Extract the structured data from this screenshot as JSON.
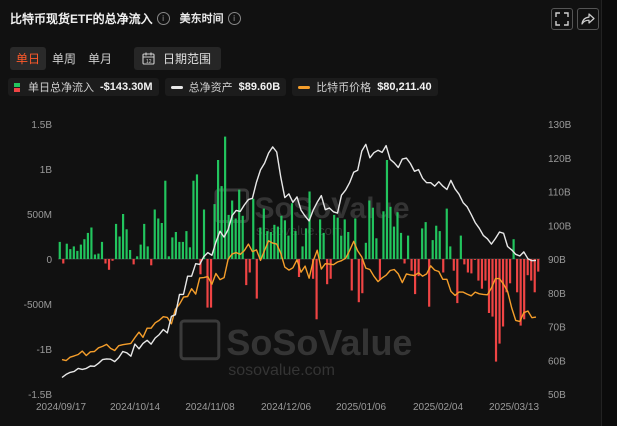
{
  "header": {
    "title": "比特币现货ETF的总净流入",
    "timezone_label": "美东时间",
    "fullscreen_icon": "fullscreen-icon",
    "share_icon": "share-icon"
  },
  "tabs": {
    "items": [
      "单日",
      "单周",
      "单月"
    ],
    "active": "单日",
    "date_range_label": "日期范围"
  },
  "legend": {
    "flow_label": "单日总净流入",
    "flow_value": "-$143.30M",
    "assets_label": "总净资产",
    "assets_value": "$89.60B",
    "price_label": "比特币价格",
    "price_value": "$80,211.40"
  },
  "watermark": {
    "brand": "SoSoValue",
    "url": "sosovalue.com"
  },
  "colors": {
    "positive": "#22c55e",
    "negative": "#ef4444",
    "assets_line": "#e8e8e8",
    "price_line": "#f59e2b",
    "background": "#111111",
    "active_tab": "#ff5a2a"
  },
  "chart_data": {
    "type": "bar",
    "left_axis": {
      "ticks": [
        "1.5B",
        "1B",
        "500M",
        "0",
        "-500M",
        "-1B",
        "-1.5B"
      ],
      "ylim": [
        -1.5,
        1.5
      ],
      "unit": "B"
    },
    "right_axis": {
      "ticks": [
        "130B",
        "120B",
        "110B",
        "100B",
        "90B",
        "80B",
        "70B",
        "60B",
        "50B"
      ],
      "ylim": [
        50,
        130
      ],
      "unit": "B"
    },
    "x_ticks": [
      "2024/09/17",
      "2024/10/14",
      "2024/11/08",
      "2024/12/06",
      "2025/01/06",
      "2025/02/04",
      "2025/03/13"
    ],
    "series": [
      {
        "name": "单日总净流入",
        "type": "bar",
        "values": [
          0.19,
          -0.05,
          0.17,
          0.11,
          0.14,
          0.09,
          0.16,
          0.22,
          0.29,
          0.35,
          0.05,
          0.06,
          0.19,
          -0.05,
          -0.12,
          -0.02,
          0.39,
          0.25,
          0.5,
          0.33,
          0.1,
          -0.06,
          0.03,
          0.16,
          0.39,
          0.14,
          -0.07,
          0.55,
          0.45,
          0.4,
          0.87,
          0.03,
          0.24,
          0.3,
          0.19,
          0.19,
          0.31,
          0.13,
          0.87,
          0.94,
          -0.17,
          0.55,
          -0.54,
          -0.54,
          0.61,
          1.1,
          0.81,
          1.36,
          0.49,
          0.65,
          0.45,
          0.77,
          0.48,
          -0.29,
          -0.15,
          0.67,
          -0.44,
          0.35,
          0.56,
          0.31,
          0.3,
          0.38,
          0.36,
          0.48,
          0.43,
          0.26,
          0.62,
          0.31,
          -0.2,
          0.14,
          0.34,
          0.75,
          -0.22,
          -0.67,
          0.44,
          0.29,
          -0.28,
          -0.22,
          0.49,
          0.46,
          0.26,
          0.44,
          0.3,
          -0.35,
          0.45,
          -0.48,
          -0.38,
          0.18,
          0.65,
          0.57,
          0.23,
          -0.23,
          0.53,
          1.1,
          0.58,
          0.36,
          0.52,
          0.29,
          -0.05,
          0.26,
          -0.13,
          -0.39,
          -0.19,
          0.34,
          0.41,
          -0.53,
          0.21,
          0.37,
          0.31,
          -0.15,
          0.56,
          0.14,
          -0.13,
          -0.49,
          0.26,
          -0.06,
          -0.15,
          -0.16,
          -0.01,
          -0.24,
          -0.33,
          -0.24,
          -0.6,
          -0.64,
          -1.14,
          -0.94,
          -0.75,
          -0.37,
          -0.27,
          0.22,
          -0.37,
          -0.74,
          -0.67,
          -0.18,
          -0.24,
          -0.37,
          -0.14
        ]
      },
      {
        "name": "总净资产",
        "type": "line",
        "values": [
          54.9,
          55.8,
          56.4,
          56.7,
          57.6,
          57.3,
          57.6,
          58.3,
          58.2,
          59.1,
          60.2,
          60.4,
          60.3,
          59.6,
          60.8,
          62.6,
          62.2,
          61.2,
          64.8,
          63.4,
          65.0,
          65.9,
          64.8,
          66.6,
          67.6,
          69.1,
          68.1,
          73.0,
          73.5,
          79.5,
          79.5,
          84.9,
          84.9,
          88.6,
          88.4,
          90.7,
          91.9,
          91.1,
          95.0,
          98.2,
          96.5,
          98.7,
          102.9,
          104.4,
          104.1,
          106.0,
          107.6,
          108.0,
          112.8,
          116.4,
          118.4,
          121.4,
          123.2,
          121.7,
          114.2,
          108.2,
          109.3,
          106.8,
          108.4,
          104.5,
          102.7,
          101.3,
          104.5,
          106.8,
          108.8,
          104.6,
          105.1,
          104.0,
          103.6,
          108.9,
          110.4,
          112.6,
          115.7,
          116.3,
          122.0,
          124.0,
          120.0,
          121.5,
          122.2,
          121.6,
          123.6,
          119.5,
          118.5,
          117.1,
          119.6,
          119.9,
          118.3,
          116.0,
          116.5,
          113.9,
          112.6,
          112.6,
          111.6,
          112.9,
          111.6,
          110.6,
          113.3,
          110.8,
          109.2,
          106.7,
          105.5,
          103.2,
          100.8,
          99.1,
          97.0,
          96.0,
          94.4,
          96.1,
          98.0,
          97.6,
          93.7,
          92.7,
          91.4,
          90.9,
          92.1,
          90.1,
          89.5,
          89.6
        ]
      },
      {
        "name": "比特币价格",
        "type": "line",
        "values": [
          60.2,
          59.9,
          60.9,
          61.3,
          61.7,
          62.7,
          61.4,
          62.5,
          62.6,
          63.7,
          64.1,
          64.7,
          63.5,
          62.9,
          64.3,
          64.6,
          64.8,
          65.0,
          66.7,
          68.3,
          66.8,
          69.5,
          69.5,
          71.1,
          71.8,
          72.9,
          72.7,
          70.8,
          75.1,
          76.6,
          78.7,
          78.9,
          81.2,
          79.6,
          84.4,
          84.5,
          84.8,
          82.5,
          85.7,
          83.9,
          84.5,
          89.9,
          91.5,
          91.9,
          91.4,
          92.5,
          94.4,
          92.2,
          92.7,
          89.6,
          92.6,
          95.4,
          94.7,
          94.4,
          91.7,
          87.6,
          86.7,
          87.4,
          89.8,
          86.1,
          87.9,
          84.3,
          89.4,
          92.6,
          87.0,
          88.6,
          88.5,
          88.3,
          89.1,
          89.5,
          90.2,
          92.5,
          95.2,
          92.4,
          90.6,
          87.3,
          86.9,
          84.9,
          83.3,
          84.4,
          85.2,
          86.6,
          86.9,
          85.6,
          83.0,
          85.6,
          85.3,
          85.1,
          85.9,
          84.9,
          85.6,
          88.0,
          86.7,
          86.3,
          84.0,
          84.0,
          80.4,
          79.2,
          80.2,
          80.2,
          79.6,
          79.1,
          80.2,
          79.7,
          79.5,
          79.4,
          81.4,
          84.2,
          84.2,
          82.5,
          80.4,
          75.5,
          71.8,
          71.5,
          74.1,
          74.6,
          72.6,
          72.8
        ]
      }
    ]
  }
}
